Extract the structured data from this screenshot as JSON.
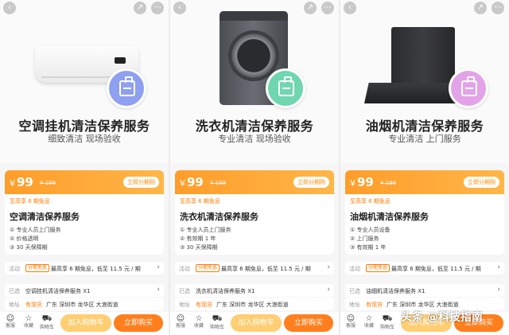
{
  "panels": [
    {
      "id": "ac",
      "title": "空调挂机清洁保养服务",
      "subtitle": "细致清洁  现场验收",
      "badge_color": "#8fa0f0",
      "price_currency": "¥",
      "price": "99",
      "old_price": "¥ 199",
      "buy_label": "立即分期购",
      "installment": "至高享 6 期免息",
      "card_title": "空调清洁保养服务",
      "features": [
        "① 专业人员上门服务",
        "② 价格透明",
        "③ 30 天保障期"
      ],
      "activity_label": "活动",
      "activity_tag": "分期免息",
      "activity_text": "最高享 6 期免息，低至 11.5 元 / 期",
      "selected_label": "已选",
      "selected_value": "空调挂机清洁保养服务  X1",
      "address_label": "地址",
      "address_stock": "有现货",
      "address_value": "广东  深圳市  龙华区  大浪街道",
      "nav": [
        "客服",
        "收藏",
        "购物车"
      ],
      "cart_label": "加入购物车",
      "buy_now_label": "立即购买"
    },
    {
      "id": "washer",
      "title": "洗衣机清洁保养服务",
      "subtitle": "专业清洁  现场验收",
      "badge_color": "#6fd6b0",
      "price_currency": "¥",
      "price": "99",
      "old_price": "¥ 199",
      "buy_label": "立即分期购",
      "installment": "至高享 6 期免息",
      "card_title": "洗衣机清洁保养服务",
      "features": [
        "① 专业人员上门服务",
        "② 有效期 1 年",
        "③ 30 天保障期"
      ],
      "activity_label": "活动",
      "activity_tag": "分期免息",
      "activity_text": "最高享 6 期免息，低至 11.5 元 / 期",
      "selected_label": "已选",
      "selected_value": "洗衣机清洁保养服务  X1",
      "address_label": "地址",
      "address_stock": "有现货",
      "address_value": "广东  深圳市  龙华区  大浪街道",
      "nav": [
        "客服",
        "收藏",
        "购物车"
      ],
      "cart_label": "加入购物车",
      "buy_now_label": "立即购买"
    },
    {
      "id": "hood",
      "title": "油烟机清洁保养服务",
      "subtitle": "专业清洁  上门服务",
      "badge_color": "#e3a3e8",
      "price_currency": "¥",
      "price": "99",
      "old_price": "¥ 199",
      "buy_label": "立即分期购",
      "installment": "至高享 6 期免息",
      "card_title": "油烟机清洁保养服务",
      "features": [
        "① 专业人员设备",
        "② 上门服务",
        "③ 有效期 1 年"
      ],
      "activity_label": "活动",
      "activity_tag": "分期免息",
      "activity_text": "最高享 6 期免息，低至 11.5 元 / 期",
      "selected_label": "已选",
      "selected_value": "油烟机清洁保养服务  X1",
      "address_label": "地址",
      "address_stock": "有现货",
      "address_value": "广东  深圳市  龙华区  大浪街道",
      "nav": [
        "客服",
        "收藏",
        "购物车"
      ],
      "cart_label": "加入购物车",
      "buy_now_label": "立即购买"
    }
  ],
  "watermark": "头条 @科技指南"
}
